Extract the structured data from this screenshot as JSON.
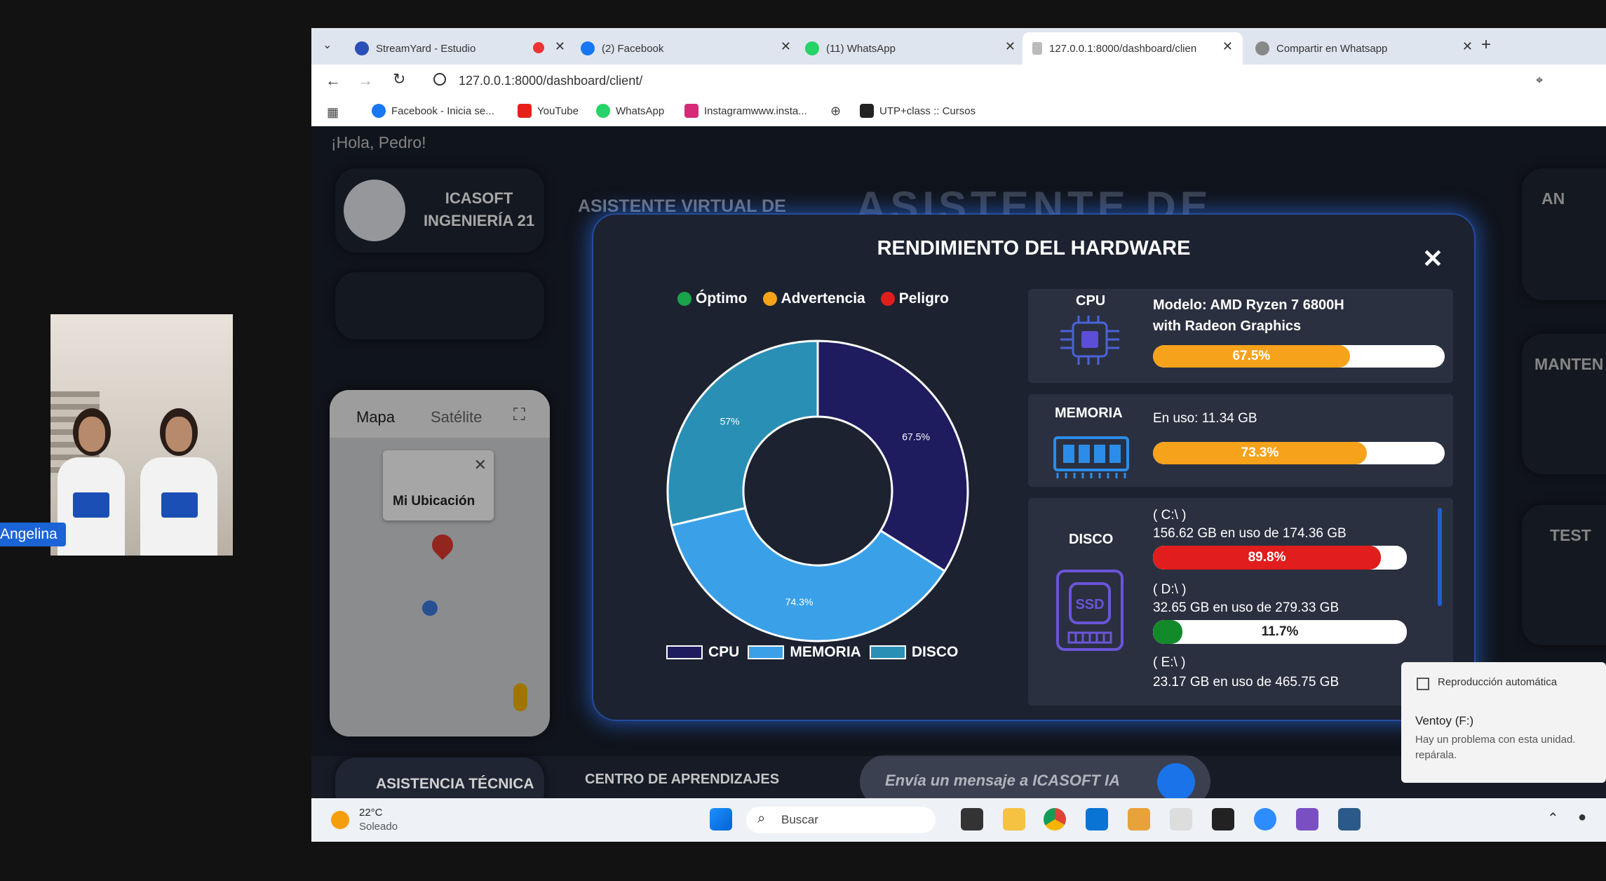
{
  "webcam": {
    "label": "Angelina"
  },
  "browser": {
    "tabs": [
      {
        "title": "StreamYard - Estudio"
      },
      {
        "title": "(2) Facebook"
      },
      {
        "title": "(11) WhatsApp"
      },
      {
        "title": "127.0.0.1:8000/dashboard/clien"
      },
      {
        "title": "Compartir en Whatsapp"
      }
    ],
    "url": "127.0.0.1:8000/dashboard/client/",
    "bookmarks": [
      {
        "label": "Facebook - Inicia se..."
      },
      {
        "label": "YouTube"
      },
      {
        "label": "WhatsApp"
      },
      {
        "label": "Instagramwww.insta..."
      },
      {
        "label": "UTP+class :: Cursos"
      }
    ]
  },
  "page": {
    "greeting": "¡Hola, Pedro!",
    "brand_line1": "ICASOFT",
    "brand_line2": "INGENIERÍA 21",
    "heading_partial": "ASISTENTE VIRTUAL DE",
    "heading_big": "ASISTENTE DE",
    "map_tab_map": "Mapa",
    "map_tab_sat": "Satélite",
    "map_popup": "Mi Ubicación",
    "support_button": "ASISTENCIA TÉCNICA",
    "learning_center": "CENTRO DE APRENDIZAJES",
    "chat_placeholder": "Envía un mensaje a ICASOFT IA",
    "right_panel_1": "AN",
    "right_panel_2": "MANTEN",
    "right_panel_3": "TEST"
  },
  "modal": {
    "title": "RENDIMIENTO DEL HARDWARE",
    "status_legend": [
      {
        "label": "Óptimo",
        "color": "#19a34a"
      },
      {
        "label": "Advertencia",
        "color": "#f6a21a"
      },
      {
        "label": "Peligro",
        "color": "#e11d1d"
      }
    ],
    "cpu": {
      "label": "CPU",
      "model_line1": "Modelo: AMD Ryzen 7 6800H",
      "model_line2": "with Radeon Graphics",
      "usage_text": "67.5%",
      "usage": 67.5,
      "color": "#f6a21a"
    },
    "memory": {
      "label": "MEMORIA",
      "in_use": "En uso: 11.34 GB",
      "usage_text": "73.3%",
      "usage": 73.3,
      "color": "#f6a21a"
    },
    "disk": {
      "label": "DISCO",
      "drives": [
        {
          "name": "( C:\\ )",
          "detail": "156.62 GB en uso de 174.36 GB",
          "usage_text": "89.8%",
          "usage": 89.8,
          "color": "#e11d1d"
        },
        {
          "name": "( D:\\ )",
          "detail": "32.65 GB en uso de 279.33 GB",
          "usage_text": "11.7%",
          "usage": 11.7,
          "color": "#138a2a"
        },
        {
          "name": "( E:\\ )",
          "detail": "23.17 GB en uso de 465.75 GB"
        }
      ]
    }
  },
  "chart_data": {
    "type": "pie",
    "title": "",
    "categories": [
      "CPU",
      "MEMORIA",
      "DISCO"
    ],
    "values": [
      67.5,
      74.3,
      57
    ],
    "value_labels": [
      "67.5%",
      "74.3%",
      "57%"
    ],
    "colors": [
      "#1e1b5e",
      "#3aa1e8",
      "#2a8fb5"
    ],
    "donut": true,
    "legend_position": "bottom"
  },
  "taskbar": {
    "weather_temp": "22°C",
    "weather_desc": "Soleado",
    "search_placeholder": "Buscar"
  },
  "toast": {
    "header": "Reproducción automática",
    "title": "Ventoy (F:)",
    "body": "Hay un problema con esta unidad. repárala."
  }
}
